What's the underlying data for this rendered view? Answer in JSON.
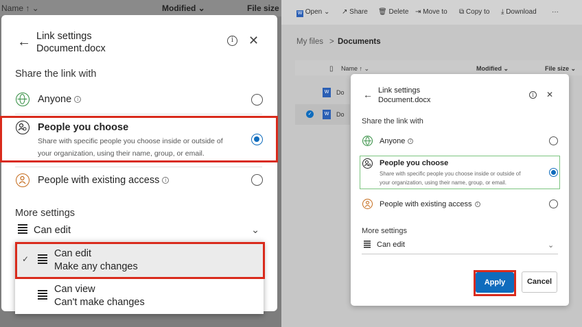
{
  "left": {
    "bg_header": {
      "col_a": "Name ↑ ⌄",
      "modified": "Modified ⌄",
      "file_size": "File size"
    },
    "dialog": {
      "title": "Link settings",
      "filename": "Document.docx",
      "info_glyph": "i",
      "close_glyph": "✕",
      "back_glyph": "←",
      "share_heading": "Share the link with",
      "options": [
        {
          "label": "Anyone",
          "icon": "globe-icon",
          "selected": false
        },
        {
          "label": "People you choose",
          "icon": "people-icon",
          "selected": true,
          "desc_line1": "Share with specific people you choose inside or outside of",
          "desc_line2": "your organization, using their name, group, or email."
        },
        {
          "label": "People with existing access",
          "icon": "person-icon",
          "selected": false
        }
      ],
      "more_settings": "More settings",
      "permission": {
        "value": "Can edit",
        "chevron": "⌄"
      },
      "dropdown": [
        {
          "title": "Can edit",
          "subtitle": "Make any changes",
          "checked": true
        },
        {
          "title": "Can view",
          "subtitle": "Can't make changes",
          "checked": false
        }
      ],
      "check_glyph": "✓"
    }
  },
  "right": {
    "toolbar": [
      {
        "label": "Open",
        "icon": "word-icon"
      },
      {
        "label": "Share",
        "icon": "share-icon"
      },
      {
        "label": "Delete",
        "icon": "trash-icon"
      },
      {
        "label": "Move to",
        "icon": "move-icon"
      },
      {
        "label": "Copy to",
        "icon": "copy-icon"
      },
      {
        "label": "Download",
        "icon": "download-icon"
      },
      {
        "label": "···",
        "icon": "more-icon"
      }
    ],
    "breadcrumb": {
      "root": "My files",
      "separator": ">",
      "current": "Documents"
    },
    "list_header": {
      "name": "Name ↑ ⌄",
      "modified": "Modified ⌄",
      "file_size": "File size ⌄"
    },
    "files": [
      {
        "name": "Do"
      },
      {
        "name": "Do"
      }
    ],
    "dialog": {
      "title": "Link settings",
      "filename": "Document.docx",
      "info_glyph": "i",
      "close_glyph": "✕",
      "back_glyph": "←",
      "share_heading": "Share the link with",
      "options": [
        {
          "label": "Anyone",
          "selected": false
        },
        {
          "label": "People you choose",
          "selected": true,
          "desc_line1": "Share with specific people you choose inside or outside of",
          "desc_line2": "your organization, using their name, group, or email."
        },
        {
          "label": "People with existing access",
          "selected": false
        }
      ],
      "more_settings": "More settings",
      "permission": {
        "value": "Can edit",
        "chevron": "⌄"
      },
      "apply": "Apply",
      "cancel": "Cancel"
    }
  },
  "colors": {
    "accent": "#0f6cbd",
    "highlight": "#d92b1c",
    "selected_outline": "#7bc47f"
  }
}
